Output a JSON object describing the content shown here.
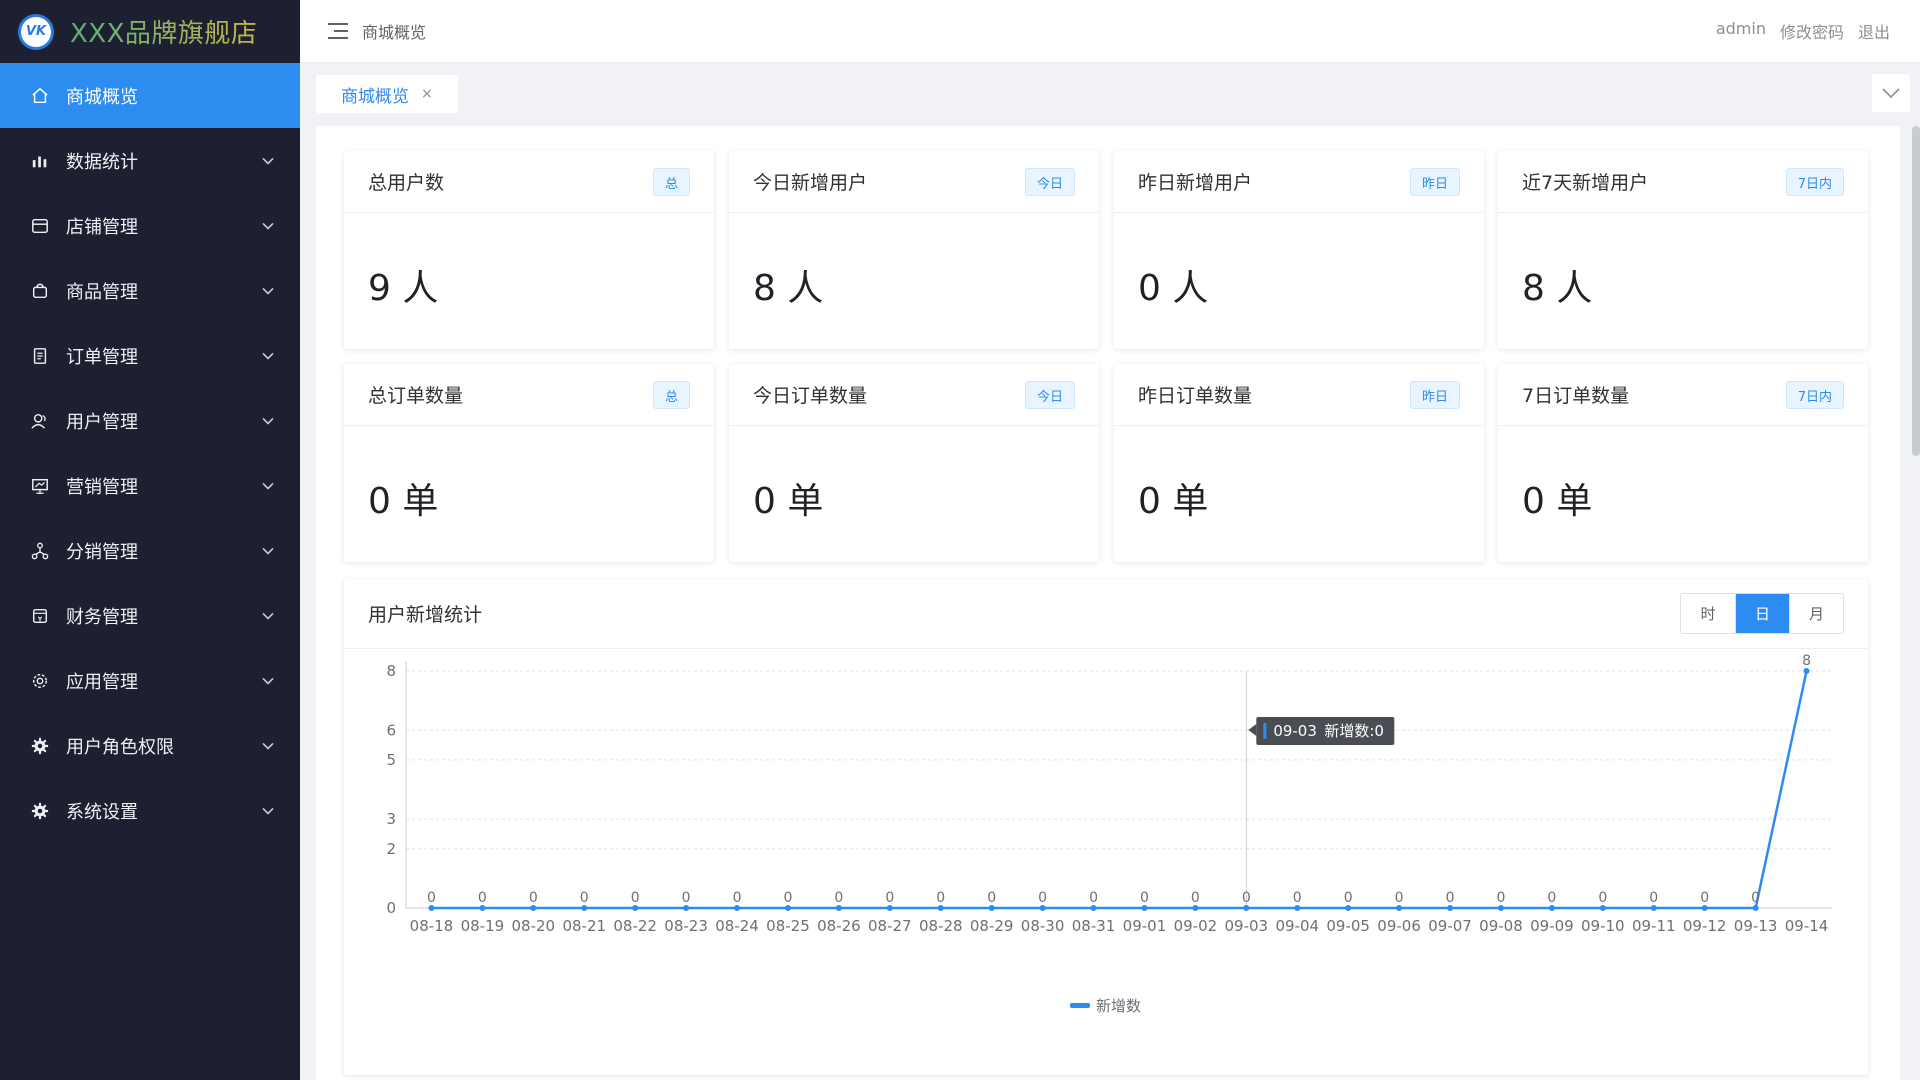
{
  "brand": {
    "logo_text": "VK",
    "title": "XXX品牌旗舰店"
  },
  "sidebar": {
    "items": [
      {
        "label": "商城概览",
        "icon": "home-icon",
        "active": true,
        "has_arrow": false
      },
      {
        "label": "数据统计",
        "icon": "bar-chart-icon",
        "has_arrow": true
      },
      {
        "label": "店铺管理",
        "icon": "store-icon",
        "has_arrow": true
      },
      {
        "label": "商品管理",
        "icon": "shopping-bag-icon",
        "has_arrow": true
      },
      {
        "label": "订单管理",
        "icon": "document-icon",
        "has_arrow": true
      },
      {
        "label": "用户管理",
        "icon": "users-icon",
        "has_arrow": true
      },
      {
        "label": "营销管理",
        "icon": "presentation-icon",
        "has_arrow": true
      },
      {
        "label": "分销管理",
        "icon": "network-icon",
        "has_arrow": true
      },
      {
        "label": "财务管理",
        "icon": "wallet-icon",
        "has_arrow": true
      },
      {
        "label": "应用管理",
        "icon": "settings-icon",
        "has_arrow": true
      },
      {
        "label": "用户角色权限",
        "icon": "gear-icon",
        "has_arrow": true
      },
      {
        "label": "系统设置",
        "icon": "gear-icon",
        "has_arrow": true
      }
    ]
  },
  "header": {
    "breadcrumb": "商城概览",
    "user": "admin",
    "change_password": "修改密码",
    "logout": "退出"
  },
  "tabs": [
    {
      "label": "商城概览",
      "close": "×"
    }
  ],
  "stats": [
    {
      "title": "总用户数",
      "badge": "总",
      "value": "9 人"
    },
    {
      "title": "今日新增用户",
      "badge": "今日",
      "value": "8 人"
    },
    {
      "title": "昨日新增用户",
      "badge": "昨日",
      "value": "0 人"
    },
    {
      "title": "近7天新增用户",
      "badge": "7日内",
      "value": "8 人"
    },
    {
      "title": "总订单数量",
      "badge": "总",
      "value": "0 单"
    },
    {
      "title": "今日订单数量",
      "badge": "今日",
      "value": "0 单"
    },
    {
      "title": "昨日订单数量",
      "badge": "昨日",
      "value": "0 单"
    },
    {
      "title": "7日订单数量",
      "badge": "7日内",
      "value": "0 单"
    }
  ],
  "chart_panel": {
    "title": "用户新增统计",
    "segments": [
      {
        "label": "时"
      },
      {
        "label": "日",
        "active": true
      },
      {
        "label": "月"
      }
    ],
    "tooltip": {
      "date": "09-03",
      "label": "新增数:0"
    }
  },
  "chart_data": {
    "type": "line",
    "categories": [
      "08-18",
      "08-19",
      "08-20",
      "08-21",
      "08-22",
      "08-23",
      "08-24",
      "08-25",
      "08-26",
      "08-27",
      "08-28",
      "08-29",
      "08-30",
      "08-31",
      "09-01",
      "09-02",
      "09-03",
      "09-04",
      "09-05",
      "09-06",
      "09-07",
      "09-08",
      "09-09",
      "09-10",
      "09-11",
      "09-12",
      "09-13",
      "09-14"
    ],
    "series": [
      {
        "name": "新增数",
        "values": [
          0,
          0,
          0,
          0,
          0,
          0,
          0,
          0,
          0,
          0,
          0,
          0,
          0,
          0,
          0,
          0,
          0,
          0,
          0,
          0,
          0,
          0,
          0,
          0,
          0,
          0,
          0,
          8
        ],
        "color": "#2d8cf0"
      }
    ],
    "y_ticks": [
      "0",
      "2",
      "3",
      "5",
      "6",
      "8"
    ],
    "ylim": [
      0,
      8
    ],
    "grid": true,
    "legend": "bottom-center",
    "data_labels": true
  },
  "colors": {
    "primary": "#2d8cf0",
    "sidebar_bg": "#1c2030"
  }
}
